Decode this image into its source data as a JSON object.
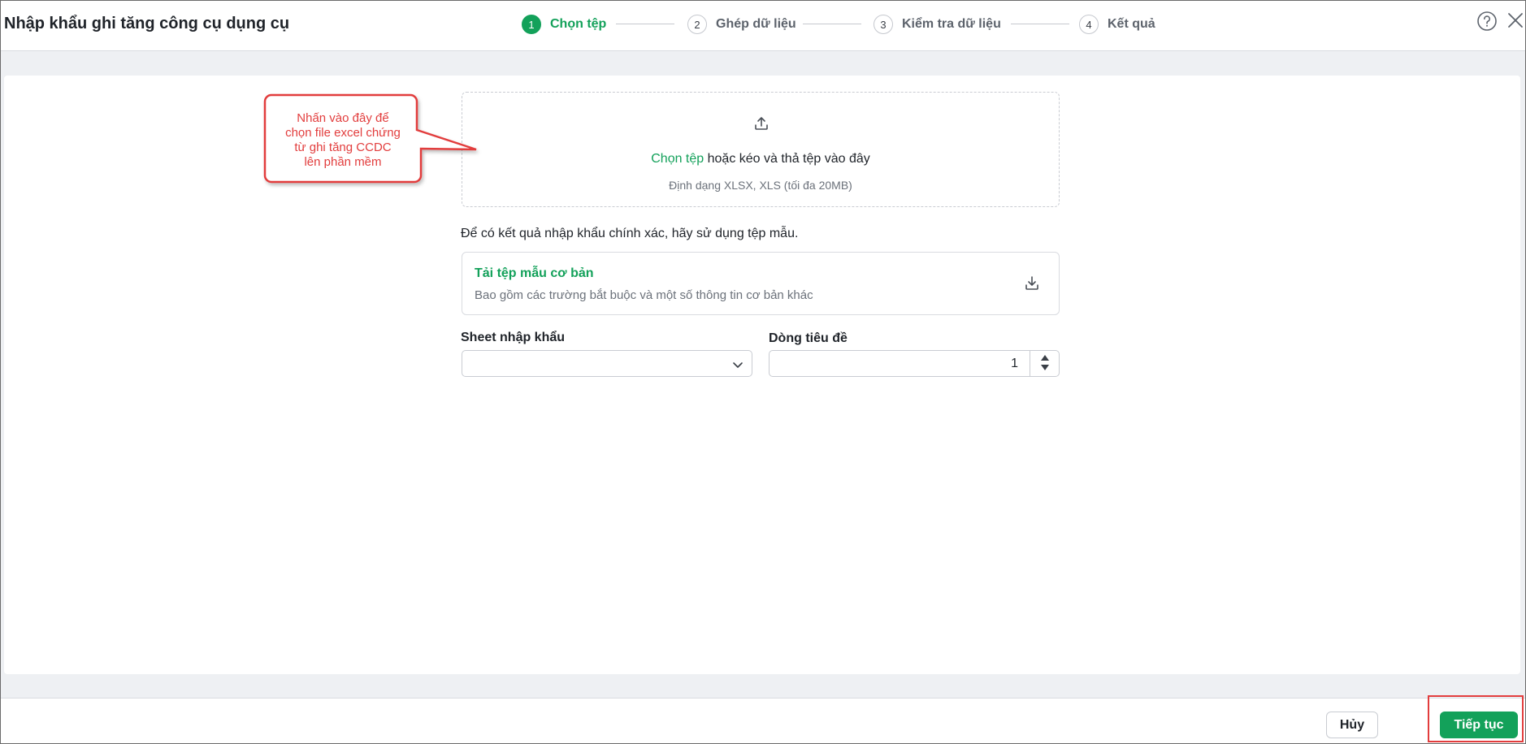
{
  "header": {
    "title": "Nhập khẩu ghi tăng công cụ dụng cụ",
    "steps": [
      {
        "number": "1",
        "label": "Chọn tệp",
        "active": true
      },
      {
        "number": "2",
        "label": "Ghép dữ liệu",
        "active": false
      },
      {
        "number": "3",
        "label": "Kiểm tra dữ liệu",
        "active": false
      },
      {
        "number": "4",
        "label": "Kết quả",
        "active": false
      }
    ],
    "help_icon": "question-circle-icon",
    "close_icon": "close-icon"
  },
  "upload": {
    "icon": "upload-icon",
    "link_label": "Chọn tệp",
    "text": " hoặc kéo và thả tệp vào đây",
    "hint": "Định dạng XLSX, XLS (tối đa 20MB)"
  },
  "template": {
    "note": "Để có kết quả nhập khẩu chính xác, hãy sử dụng tệp mẫu.",
    "title": "Tải tệp mẫu cơ bản",
    "description": "Bao gồm các trường bắt buộc và một số thông tin cơ bản khác",
    "icon": "download-icon"
  },
  "fields": {
    "sheet_label": "Sheet nhập khẩu",
    "sheet_value": "",
    "header_row_label": "Dòng tiêu đề",
    "header_row_value": "1"
  },
  "callout": {
    "line1": "Nhấn vào đây để",
    "line2": "chọn file excel chứng",
    "line3": "từ ghi tăng CCDC",
    "line4": "lên phần mềm"
  },
  "footer": {
    "cancel_label": "Hủy",
    "next_label": "Tiếp tục"
  },
  "colors": {
    "accent": "#13a15a",
    "annotation": "#e23d3d"
  }
}
